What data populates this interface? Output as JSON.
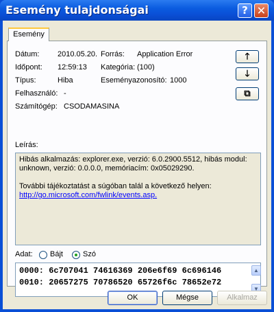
{
  "window": {
    "title": "Esemény tulajdonságai"
  },
  "titlebar": {
    "help_glyph": "?",
    "close_glyph": "✕"
  },
  "tabs": [
    {
      "label": "Esemény"
    }
  ],
  "event": {
    "date_label": "Dátum:",
    "date_value": "2010.05.20.",
    "time_label": "Időpont:",
    "time_value": "12:59:13",
    "type_label": "Típus:",
    "type_value": "Hiba",
    "user_label": "Felhasználó:",
    "user_value": "-",
    "computer_label": "Számítógép:",
    "computer_value": "CSODAMASINA",
    "source_label": "Forrás:",
    "source_value": "Application Error",
    "category_label": "Kategória:",
    "category_value": "(100)",
    "event_id_label": "Eseményazonosító:",
    "event_id_value": "1000"
  },
  "nav": {
    "up_glyph": "🡑",
    "down_glyph": "🡓",
    "copy_glyph": "⧉"
  },
  "description": {
    "label": "Leírás:",
    "text": "Hibás alkalmazás: explorer.exe, verzió: 6.0.2900.5512, hibás modul: unknown, verzió: 0.0.0.0, memóriacím: 0x05029290.",
    "help_text": "További tájékoztatást a súgóban talál a következő helyen:",
    "link": "http://go.microsoft.com/fwlink/events.asp."
  },
  "data": {
    "label": "Adat:",
    "options": [
      {
        "label": "Bájt",
        "checked": false
      },
      {
        "label": "Szó",
        "checked": true
      }
    ],
    "lines": [
      "0000: 6c707041 74616369 206e6f69 6c696146",
      "0010: 20657275 70786520 65726f6c 78652e72"
    ]
  },
  "buttons": {
    "ok": "OK",
    "cancel": "Mégse",
    "apply": "Alkalmaz"
  },
  "colors": {
    "titlebar": "#0a4fd6",
    "dialog_bg": "#ece9d8",
    "link": "#0000ff",
    "tab_accent": "#ffc83c"
  }
}
